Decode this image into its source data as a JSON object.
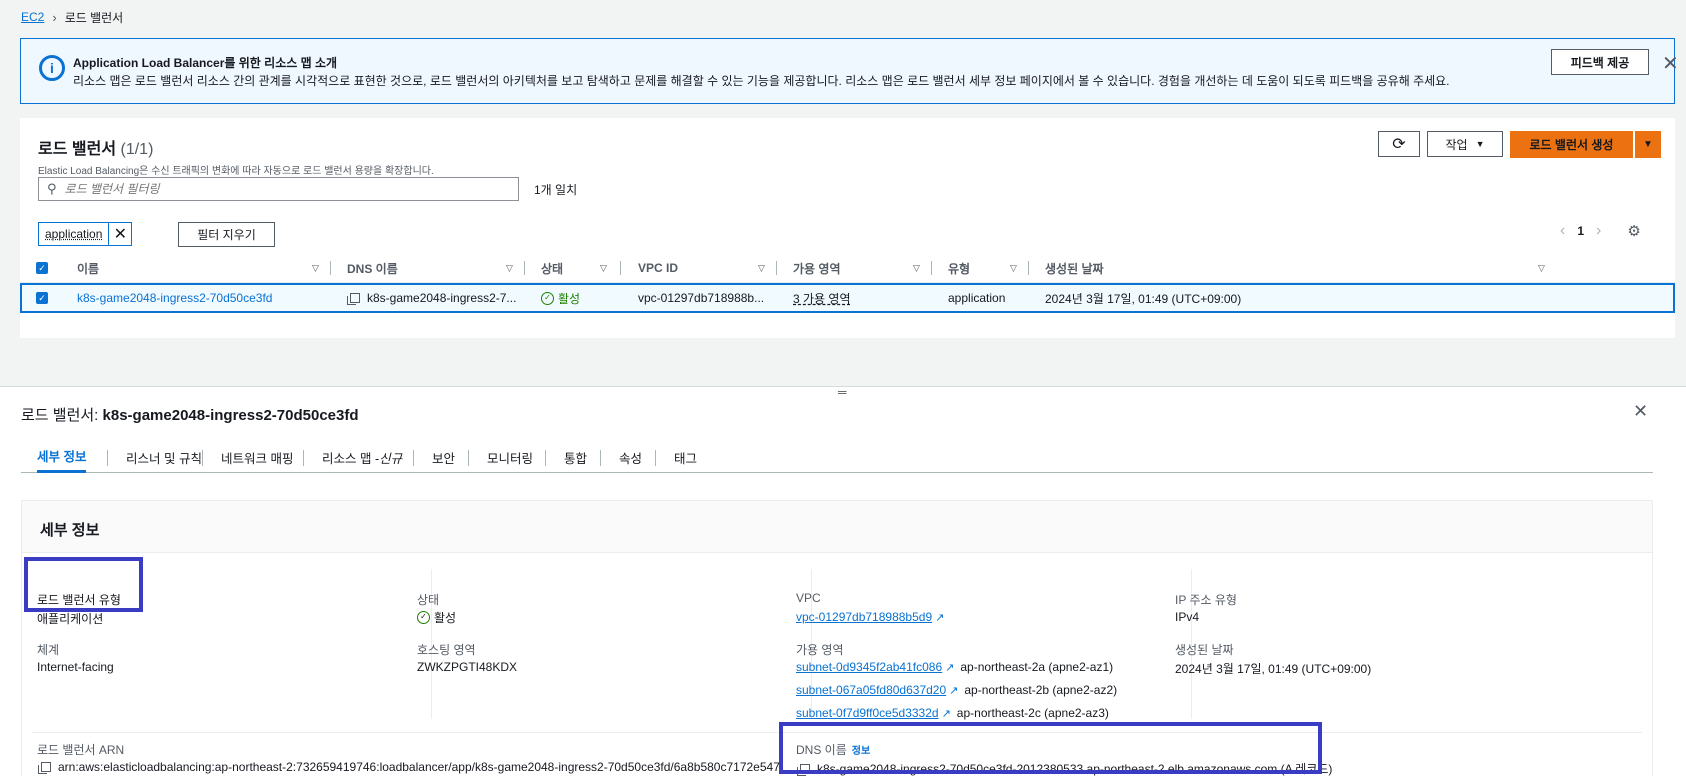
{
  "breadcrumb": {
    "root": "EC2",
    "current": "로드 밸런서"
  },
  "flash": {
    "title": "Application Load Balancer를 위한 리소스 맵 소개",
    "body": "리소스 맵은 로드 밸런서 리소스 간의 관계를 시각적으로 표현한 것으로, 로드 밸런서의 아키텍처를 보고 탐색하고 문제를 해결할 수 있는 기능을 제공합니다. 리소스 맵은 로드 밸런서 세부 정보 페이지에서 볼 수 있습니다. 경험을 개선하는 데 도움이 되도록 피드백을 공유해 주세요.",
    "feedback_label": "피드백 제공"
  },
  "lb_list": {
    "title": "로드 밸런서",
    "count": "(1/1)",
    "description": "Elastic Load Balancing은 수신 트래픽의 변화에 따라 자동으로 로드 밸런서 용량을 확장합니다.",
    "action_label": "작업",
    "create_label": "로드 밸런서 생성",
    "search_placeholder": "로드 밸런서 필터링",
    "match_text": "1개 일치",
    "token_label": "application",
    "clear_filters_label": "필터 지우기",
    "page": "1",
    "columns": [
      "이름",
      "DNS 이름",
      "상태",
      "VPC ID",
      "가용 영역",
      "유형",
      "생성된 날짜"
    ],
    "row": {
      "name": "k8s-game2048-ingress2-70d50ce3fd",
      "dns": "k8s-game2048-ingress2-7...",
      "status": "활성",
      "vpc": "vpc-01297db718988b...",
      "az": "3 가용 영역",
      "type": "application",
      "created": "2024년 3월 17일, 01:49 (UTC+09:00)"
    }
  },
  "detail": {
    "title_lead": "로드 밸런서:",
    "title_name": "k8s-game2048-ingress2-70d50ce3fd",
    "tabs": [
      "세부 정보",
      "리스너 및 규칙",
      "네트워크 매핑",
      "리소스 맵 - ",
      "신규",
      "보안",
      "모니터링",
      "통합",
      "속성",
      "태그"
    ],
    "section_title": "세부 정보",
    "fields": {
      "lb_type_label": "로드 밸런서 유형",
      "lb_type_value": "애플리케이션",
      "scheme_label": "체계",
      "scheme_value": "Internet-facing",
      "status_label": "상태",
      "status_value": "활성",
      "hosted_zone_label": "호스팅 영역",
      "hosted_zone_value": "ZWKZPGTI48KDX",
      "vpc_label": "VPC",
      "vpc_value": "vpc-01297db718988b5d9",
      "az_label": "가용 영역",
      "az": [
        {
          "subnet": "subnet-0d9345f2ab41fc086",
          "zone": "ap-northeast-2a (apne2-az1)"
        },
        {
          "subnet": "subnet-067a05fd80d637d20",
          "zone": "ap-northeast-2b (apne2-az2)"
        },
        {
          "subnet": "subnet-0f7d9ff0ce5d3332d",
          "zone": "ap-northeast-2c (apne2-az3)"
        }
      ],
      "ip_type_label": "IP 주소 유형",
      "ip_type_value": "IPv4",
      "created_label": "생성된 날짜",
      "created_value": "2024년 3월 17일, 01:49 (UTC+09:00)",
      "arn_label": "로드 밸런서 ARN",
      "arn_value": "arn:aws:elasticloadbalancing:ap-northeast-2:732659419746:loadbalancer/app/k8s-game2048-ingress2-70d50ce3fd/6a8b580c7172e547",
      "dns_label": "DNS 이름",
      "dns_info": "정보",
      "dns_value": "k8s-game2048-ingress2-70d50ce3fd-2012380533.ap-northeast-2.elb.amazonaws.com (A 레코드)"
    }
  },
  "colors": {
    "primary": "#ec7211",
    "link": "#0972d3",
    "success": "#1d8102",
    "highlight": "#3a3dc4"
  }
}
